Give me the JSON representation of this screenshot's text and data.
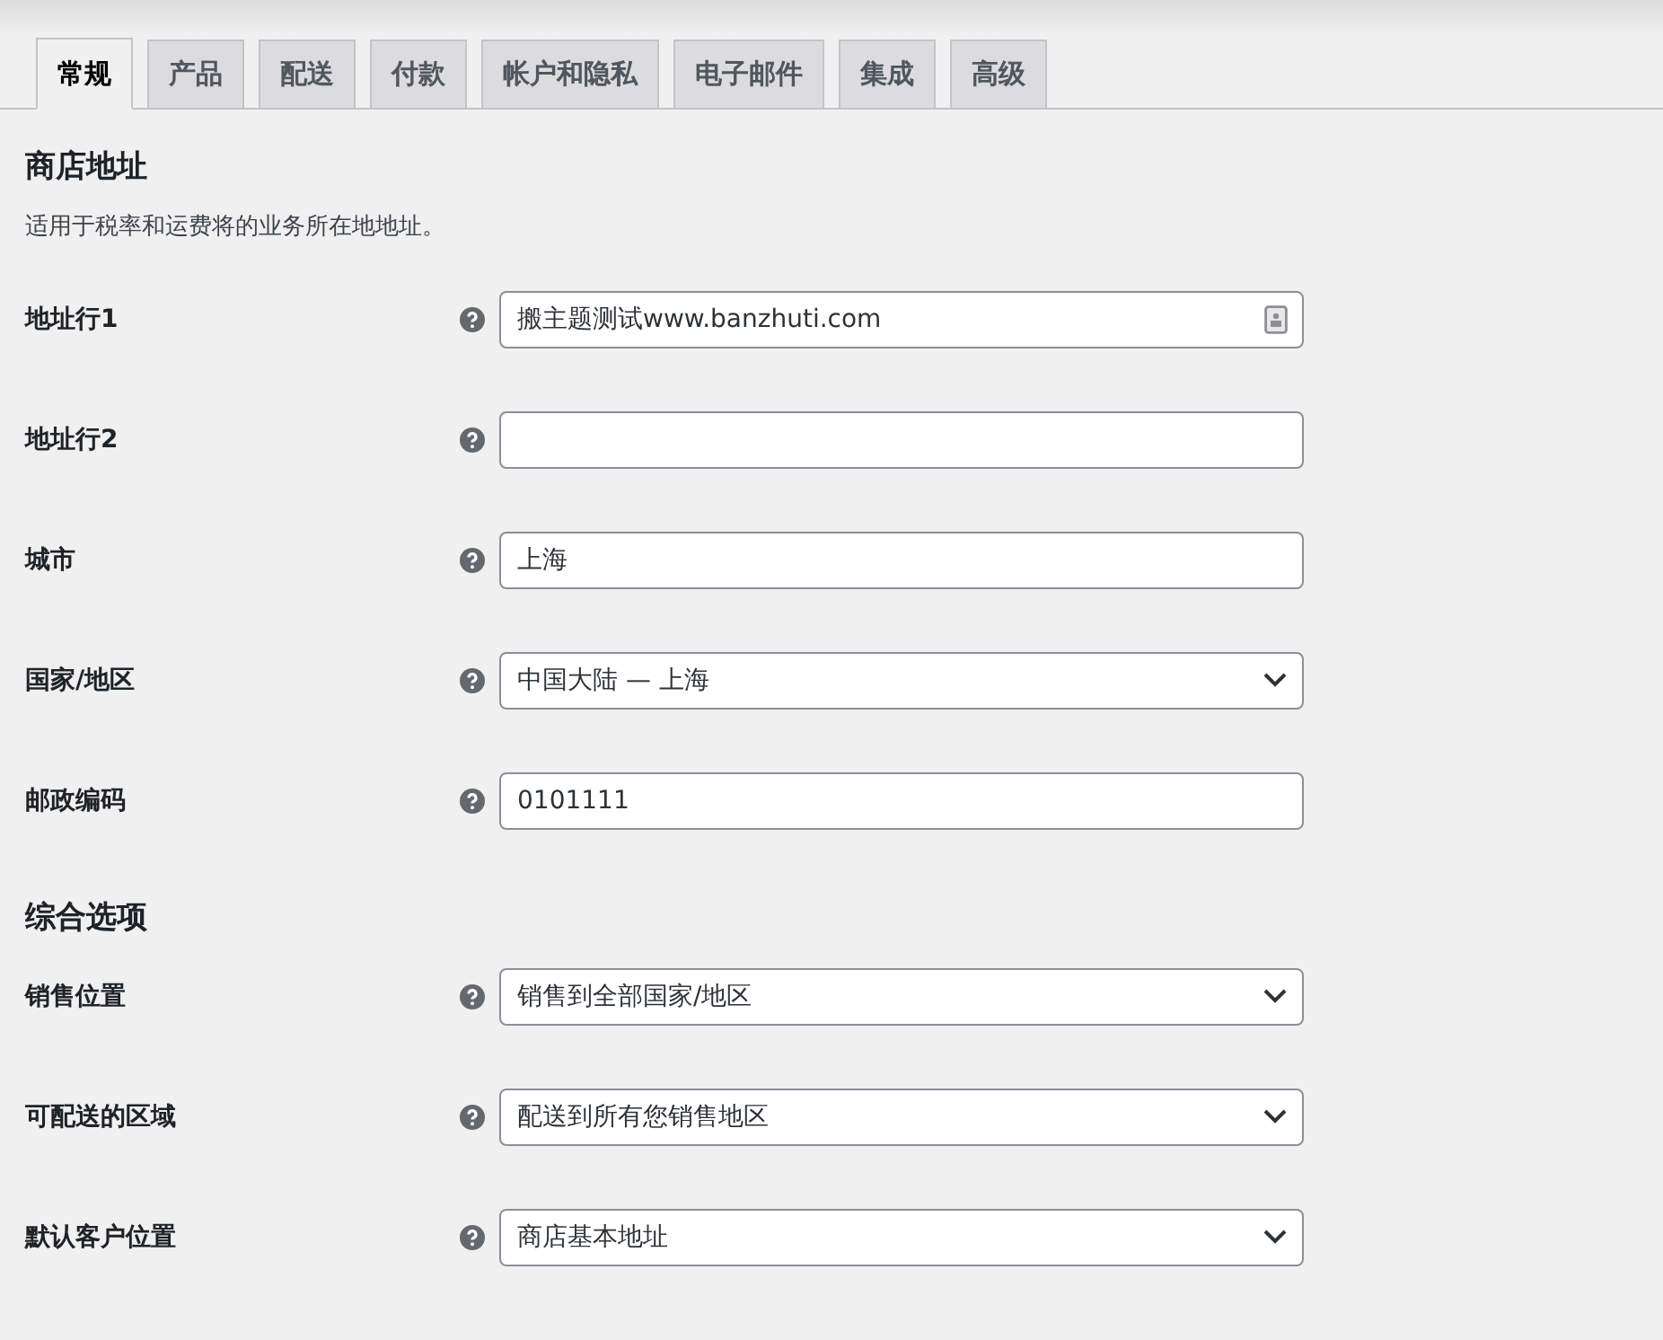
{
  "tabs": [
    {
      "label": "常规",
      "selected": true
    },
    {
      "label": "产品",
      "selected": false
    },
    {
      "label": "配送",
      "selected": false
    },
    {
      "label": "付款",
      "selected": false
    },
    {
      "label": "帐户和隐私",
      "selected": false
    },
    {
      "label": "电子邮件",
      "selected": false
    },
    {
      "label": "集成",
      "selected": false
    },
    {
      "label": "高级",
      "selected": false
    }
  ],
  "sections": [
    {
      "title": "商店地址",
      "description": "适用于税率和运费将的业务所在地地址。",
      "rows": [
        {
          "label": "地址行1",
          "kind": "text",
          "value": "搬主题测试www.banzhuti.com",
          "autofill": true
        },
        {
          "label": "地址行2",
          "kind": "text",
          "autofill": false
        },
        {
          "label": "城市",
          "kind": "text",
          "value": "上海",
          "autofill": false
        },
        {
          "label": "国家/地区",
          "kind": "select",
          "value": "中国大陆 — 上海"
        },
        {
          "label": "邮政编码",
          "kind": "text",
          "value": "0101111",
          "autofill": false
        }
      ]
    },
    {
      "title": "综合选项",
      "rows": [
        {
          "label": "销售位置",
          "kind": "select",
          "value": "销售到全部国家/地区"
        },
        {
          "label": "可配送的区域",
          "kind": "select",
          "value": "配送到所有您销售地区"
        },
        {
          "label": "默认客户位置",
          "kind": "select",
          "value": "商店基本地址"
        }
      ]
    }
  ]
}
